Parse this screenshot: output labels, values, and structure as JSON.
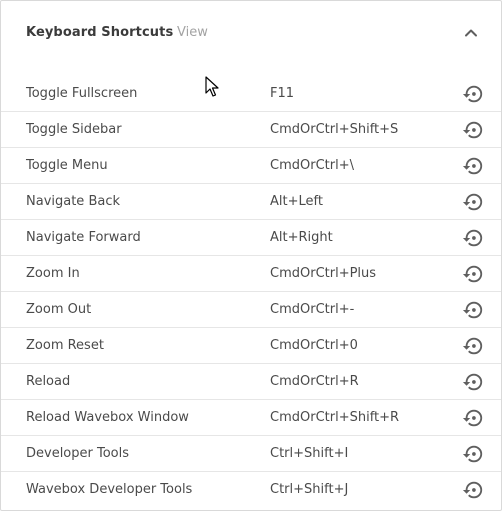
{
  "header": {
    "title": "Keyboard Shortcuts",
    "view_label": "View",
    "collapse_icon": "chevron-up-icon"
  },
  "shortcuts": [
    {
      "name": "Toggle Fullscreen",
      "accelerator": "F11"
    },
    {
      "name": "Toggle Sidebar",
      "accelerator": "CmdOrCtrl+Shift+S"
    },
    {
      "name": "Toggle Menu",
      "accelerator": "CmdOrCtrl+\\"
    },
    {
      "name": "Navigate Back",
      "accelerator": "Alt+Left"
    },
    {
      "name": "Navigate Forward",
      "accelerator": "Alt+Right"
    },
    {
      "name": "Zoom In",
      "accelerator": "CmdOrCtrl+Plus"
    },
    {
      "name": "Zoom Out",
      "accelerator": "CmdOrCtrl+-"
    },
    {
      "name": "Zoom Reset",
      "accelerator": "CmdOrCtrl+0"
    },
    {
      "name": "Reload",
      "accelerator": "CmdOrCtrl+R"
    },
    {
      "name": "Reload Wavebox Window",
      "accelerator": "CmdOrCtrl+Shift+R"
    },
    {
      "name": "Developer Tools",
      "accelerator": "Ctrl+Shift+I"
    },
    {
      "name": "Wavebox Developer Tools",
      "accelerator": "Ctrl+Shift+J"
    }
  ],
  "row_action_icon": "restore-icon",
  "colors": {
    "text": "#4a4a4a",
    "title": "#3b3b3b",
    "muted": "#a3a3a3",
    "icon": "#5f5f5f",
    "divider": "#e6e6e6"
  }
}
